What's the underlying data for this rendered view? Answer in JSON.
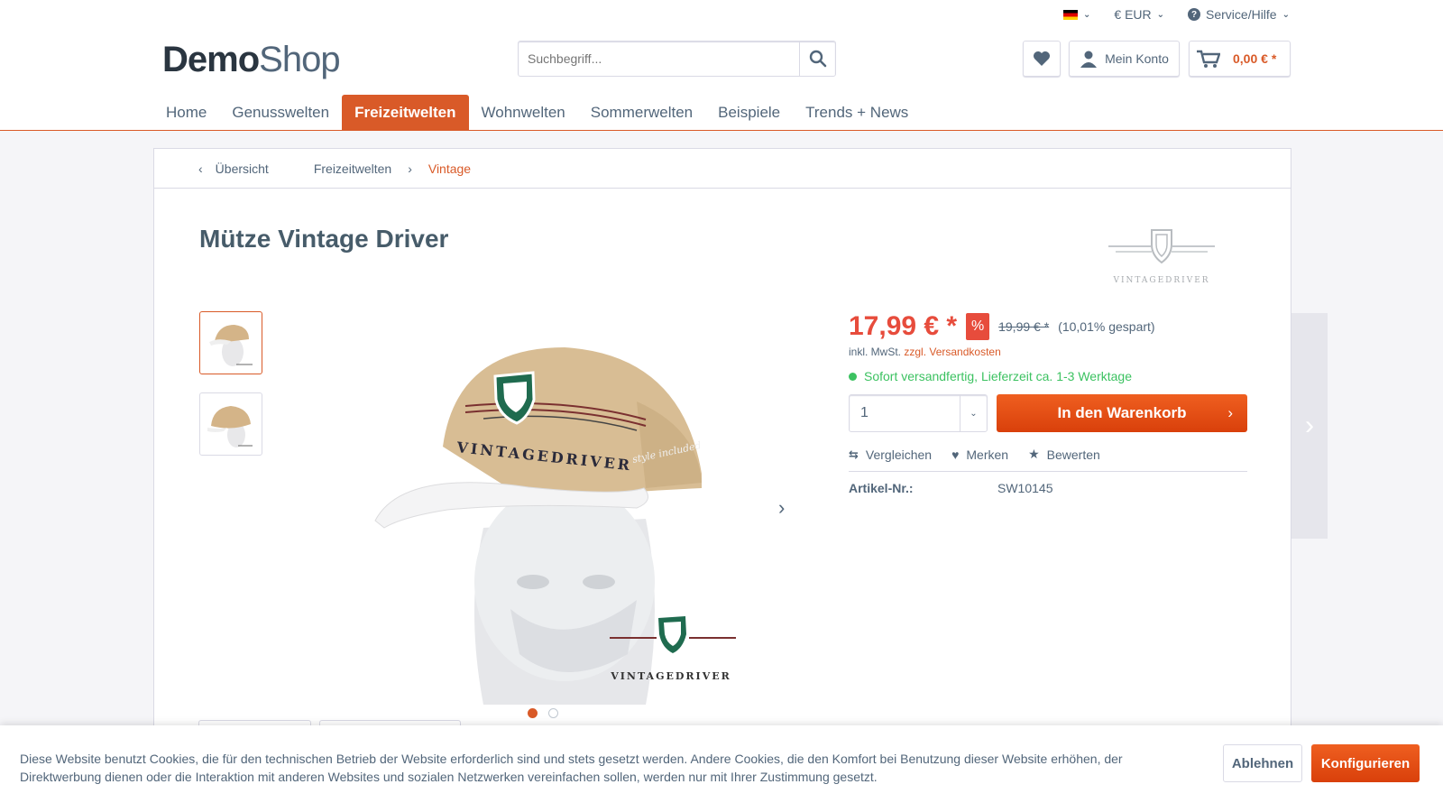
{
  "top_links": {
    "currency": "€ EUR",
    "service": "Service/Hilfe"
  },
  "logo": {
    "bold": "Demo",
    "light": "Shop"
  },
  "search": {
    "placeholder": "Suchbegriff..."
  },
  "header": {
    "account_label": "Mein Konto",
    "cart_total": "0,00 € *"
  },
  "nav": [
    {
      "label": "Home"
    },
    {
      "label": "Genusswelten"
    },
    {
      "label": "Freizeitwelten",
      "active": true
    },
    {
      "label": "Wohnwelten"
    },
    {
      "label": "Sommerwelten"
    },
    {
      "label": "Beispiele"
    },
    {
      "label": "Trends + News"
    }
  ],
  "breadcrumb": {
    "back": "Übersicht",
    "items": [
      "Freizeitwelten",
      "Vintage"
    ]
  },
  "product": {
    "title": "Mütze Vintage Driver",
    "brand_text": "VINTAGEDRIVER",
    "price": "17,99 € *",
    "discount_badge": "%",
    "old_price": "19,99 € *",
    "saved": "(10,01% gespart)",
    "tax_prefix": "inkl. MwSt.",
    "shipping_link": "zzgl. Versandkosten",
    "delivery": "Sofort versandfertig, Lieferzeit ca. 1-3 Werktage",
    "quantity": "1",
    "add_to_cart": "In den Warenkorb",
    "actions": {
      "compare": "Vergleichen",
      "remember": "Merken",
      "rate": "Bewerten"
    },
    "article_label": "Artikel-Nr.:",
    "article_number": "SW10145",
    "image_cap_text": "VINTAGEDRIVER",
    "image_cap_script": "style included",
    "image_logo_text": "VINTAGEDRIVER"
  },
  "cookie": {
    "text": "Diese Website benutzt Cookies, die für den technischen Betrieb der Website erforderlich sind und stets gesetzt werden. Andere Cookies, die den Komfort bei Benutzung dieser Website erhöhen, der Direktwerbung dienen oder die Interaktion mit anderen Websites und sozialen Netzwerken vereinfachen sollen, werden nur mit Ihrer Zustimmung gesetzt.",
    "decline": "Ablehnen",
    "configure": "Konfigurieren"
  },
  "colors": {
    "accent": "#d95a28",
    "price": "#e74c3c",
    "delivery": "#3cc261",
    "text": "#52667a"
  }
}
